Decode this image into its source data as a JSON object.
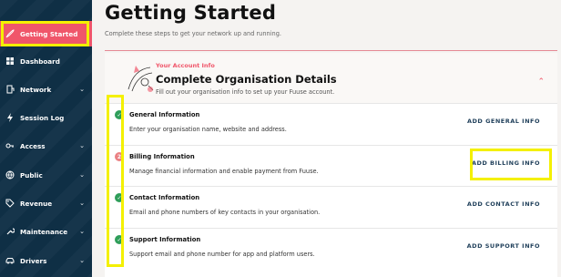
{
  "sidebar": {
    "items": [
      {
        "label": "Getting Started",
        "icon": "rocket-icon",
        "active": true,
        "chevron": false
      },
      {
        "label": "Dashboard",
        "icon": "dashboard-icon",
        "active": false,
        "chevron": false
      },
      {
        "label": "Network",
        "icon": "network-icon",
        "active": false,
        "chevron": true
      },
      {
        "label": "Session Log",
        "icon": "lightning-icon",
        "active": false,
        "chevron": false
      },
      {
        "label": "Access",
        "icon": "key-icon",
        "active": false,
        "chevron": true
      },
      {
        "label": "Public",
        "icon": "globe-icon",
        "active": false,
        "chevron": true
      },
      {
        "label": "Revenue",
        "icon": "tag-icon",
        "active": false,
        "chevron": true
      },
      {
        "label": "Maintenance",
        "icon": "wrench-icon",
        "active": false,
        "chevron": true
      },
      {
        "label": "Drivers",
        "icon": "car-icon",
        "active": false,
        "chevron": true
      }
    ]
  },
  "page": {
    "title": "Getting Started",
    "subtitle": "Complete these steps to get your network up and running."
  },
  "card": {
    "eyebrow": "Your Account Info",
    "title": "Complete Organisation Details",
    "description": "Fill out your organisation info to set up your Fuuse account.",
    "steps": [
      {
        "title": "General Information",
        "description": "Enter your organisation name, website and address.",
        "action": "ADD GENERAL INFO",
        "status": "done",
        "marker": "✓"
      },
      {
        "title": "Billing Information",
        "description": "Manage financial information and enable payment from Fuuse.",
        "action": "ADD BILLING INFO",
        "status": "todo",
        "marker": "2"
      },
      {
        "title": "Contact Information",
        "description": "Email and phone numbers of key contacts in your organisation.",
        "action": "ADD CONTACT INFO",
        "status": "done",
        "marker": "✓"
      },
      {
        "title": "Support Information",
        "description": "Support email and phone number for app and platform users.",
        "action": "ADD SUPPORT INFO",
        "status": "done",
        "marker": "✓"
      }
    ]
  },
  "colors": {
    "accent": "#f0566a",
    "sidebar": "#0f2f45",
    "success": "#2f9e5a",
    "highlight": "#f4f000"
  }
}
